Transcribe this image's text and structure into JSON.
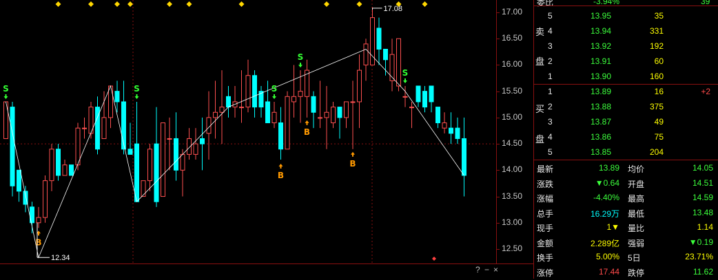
{
  "y_axis": {
    "ticks": [
      "17.00",
      "16.50",
      "16.00",
      "15.50",
      "15.00",
      "14.50",
      "14.00",
      "13.50",
      "13.00",
      "12.50"
    ]
  },
  "annotations": {
    "high": "17.08",
    "low": "12.34"
  },
  "signals": {
    "buy": "B",
    "sell": "S"
  },
  "candles": [
    [
      14.6,
      15.3,
      14.7,
      15.3
    ],
    [
      15.2,
      15.3,
      13.5,
      13.7
    ],
    [
      14.0,
      14.0,
      13.4,
      13.6
    ],
    [
      13.6,
      13.7,
      13.2,
      13.35
    ],
    [
      13.3,
      13.4,
      12.8,
      13.0
    ],
    [
      13.0,
      13.3,
      12.9,
      13.1
    ],
    [
      13.1,
      13.9,
      13.0,
      13.8
    ],
    [
      13.8,
      14.5,
      13.6,
      14.4
    ],
    [
      14.4,
      14.5,
      13.8,
      13.9
    ],
    [
      13.9,
      14.2,
      13.9,
      14.1
    ],
    [
      14.1,
      14.0,
      13.9,
      13.9
    ],
    [
      14.1,
      14.9,
      14.0,
      14.8
    ],
    [
      14.8,
      15.0,
      14.6,
      14.8
    ],
    [
      14.7,
      15.3,
      14.6,
      15.2
    ],
    [
      15.2,
      15.4,
      14.3,
      14.4
    ],
    [
      14.6,
      15.5,
      14.6,
      15.0
    ],
    [
      15.0,
      15.6,
      14.8,
      15.6
    ],
    [
      15.5,
      15.7,
      15.1,
      15.3
    ],
    [
      15.3,
      15.7,
      14.3,
      14.4
    ],
    [
      14.4,
      14.9,
      14.3,
      14.3
    ],
    [
      14.5,
      15.3,
      13.4,
      13.4
    ],
    [
      13.5,
      13.8,
      13.5,
      13.8
    ],
    [
      13.8,
      14.5,
      13.6,
      14.4
    ],
    [
      14.5,
      15.2,
      13.3,
      13.4
    ],
    [
      13.5,
      14.9,
      13.5,
      14.9
    ],
    [
      14.6,
      15.0,
      14.0,
      14.6
    ],
    [
      14.6,
      15.1,
      13.8,
      14.0
    ],
    [
      14.0,
      14.4,
      13.5,
      14.3
    ],
    [
      14.3,
      14.8,
      14.2,
      14.6
    ],
    [
      14.3,
      14.8,
      14.2,
      14.5
    ],
    [
      14.6,
      15.0,
      14.0,
      14.5
    ],
    [
      14.7,
      15.5,
      14.2,
      15.0
    ],
    [
      15.0,
      15.7,
      14.6,
      15.1
    ],
    [
      15.1,
      15.9,
      14.5,
      15.2
    ],
    [
      15.4,
      15.6,
      15.0,
      15.2
    ],
    [
      15.2,
      15.6,
      15.0,
      15.3
    ],
    [
      15.2,
      15.9,
      14.9,
      15.2
    ],
    [
      15.2,
      16.1,
      15.1,
      15.8
    ],
    [
      15.8,
      15.9,
      15.0,
      15.2
    ],
    [
      15.5,
      15.6,
      15.0,
      15.2
    ],
    [
      15.3,
      15.7,
      14.9,
      14.9
    ],
    [
      14.9,
      15.3,
      14.8,
      15.1
    ],
    [
      14.9,
      15.2,
      14.2,
      14.4
    ],
    [
      14.4,
      15.5,
      14.4,
      15.4
    ],
    [
      15.3,
      16.0,
      15.0,
      15.4
    ],
    [
      15.4,
      15.9,
      14.9,
      15.5
    ],
    [
      15.4,
      16.1,
      15.0,
      15.9
    ],
    [
      15.4,
      15.5,
      14.8,
      15.1
    ],
    [
      15.0,
      15.7,
      14.8,
      15.0
    ],
    [
      15.0,
      15.6,
      14.4,
      15.1
    ],
    [
      14.9,
      15.3,
      14.8,
      15.2
    ],
    [
      15.2,
      15.2,
      14.6,
      15.0
    ],
    [
      15.0,
      15.3,
      14.8,
      15.3
    ],
    [
      15.3,
      15.7,
      14.4,
      15.3
    ],
    [
      15.3,
      16.2,
      14.8,
      15.9
    ],
    [
      16.0,
      16.5,
      15.7,
      16.4
    ],
    [
      16.0,
      17.1,
      16.3,
      16.9
    ],
    [
      16.7,
      16.9,
      16.0,
      16.3
    ],
    [
      16.3,
      16.3,
      15.8,
      16.1
    ],
    [
      15.7,
      16.5,
      15.5,
      16.2
    ],
    [
      15.6,
      16.5,
      15.5,
      16.5
    ],
    [
      15.4,
      15.6,
      15.2,
      15.4
    ],
    [
      15.2,
      15.3,
      14.8,
      15.2
    ],
    [
      15.6,
      15.6,
      15.2,
      15.3
    ],
    [
      15.5,
      15.6,
      15.1,
      15.2
    ],
    [
      15.6,
      15.6,
      15.1,
      15.3
    ],
    [
      15.2,
      15.2,
      14.8,
      14.9
    ],
    [
      14.8,
      15.1,
      14.7,
      14.9
    ],
    [
      14.8,
      15.1,
      14.5,
      14.7
    ],
    [
      14.8,
      15.0,
      14.5,
      14.6
    ],
    [
      14.6,
      15.0,
      13.5,
      13.9
    ]
  ],
  "buy_signals": [
    5,
    42,
    46,
    53
  ],
  "sell_signals": [
    0,
    20,
    41,
    45,
    61
  ],
  "buy_marker_low_offset": [
    4,
    6,
    4,
    4
  ],
  "zigzag": [
    [
      15.3,
      0
    ],
    [
      12.34,
      5
    ],
    [
      15.6,
      16
    ],
    [
      13.4,
      20
    ],
    [
      15.2,
      34
    ],
    [
      16.3,
      55
    ],
    [
      15.5,
      61
    ],
    [
      13.9,
      70
    ]
  ],
  "top_markers": [
    8,
    13,
    17,
    19,
    25,
    28,
    36,
    49,
    54,
    60,
    64
  ],
  "extra_markers": [
    {
      "price": 12.5,
      "idx": 65
    }
  ],
  "bottom_controls": [
    "?",
    "−",
    "×"
  ],
  "order_book": {
    "header": {
      "label": "委比",
      "value": "-3.94%",
      "diff": "39"
    },
    "ask_side": "卖盘",
    "bid_side": "买盘",
    "asks": [
      {
        "level": "5",
        "price": "13.95",
        "volume": "35",
        "change": ""
      },
      {
        "level": "4",
        "price": "13.94",
        "volume": "331",
        "change": ""
      },
      {
        "level": "3",
        "price": "13.92",
        "volume": "192",
        "change": ""
      },
      {
        "level": "2",
        "price": "13.91",
        "volume": "60",
        "change": ""
      },
      {
        "level": "1",
        "price": "13.90",
        "volume": "160",
        "change": ""
      }
    ],
    "bids": [
      {
        "level": "1",
        "price": "13.89",
        "volume": "16",
        "change": "+2"
      },
      {
        "level": "2",
        "price": "13.88",
        "volume": "375",
        "change": ""
      },
      {
        "level": "3",
        "price": "13.87",
        "volume": "49",
        "change": ""
      },
      {
        "level": "4",
        "price": "13.86",
        "volume": "75",
        "change": ""
      },
      {
        "level": "5",
        "price": "13.85",
        "volume": "204",
        "change": ""
      }
    ]
  },
  "stats": [
    {
      "l1": "最新",
      "v1": "13.89",
      "c1": "green",
      "l2": "均价",
      "v2": "14.05",
      "c2": "green"
    },
    {
      "l1": "涨跌",
      "v1": "▼0.64",
      "c1": "green",
      "l2": "开盘",
      "v2": "14.51",
      "c2": "green"
    },
    {
      "l1": "涨幅",
      "v1": "-4.40%",
      "c1": "green",
      "l2": "最高",
      "v2": "14.59",
      "c2": "green"
    },
    {
      "l1": "总手",
      "v1": "16.29万",
      "c1": "cyan",
      "l2": "最低",
      "v2": "13.48",
      "c2": "green"
    },
    {
      "l1": "现手",
      "v1": "1▼",
      "c1": "yellow",
      "l2": "量比",
      "v2": "1.14",
      "c2": "yellow"
    },
    {
      "l1": "金额",
      "v1": "2.289亿",
      "c1": "yellow",
      "l2": "强弱",
      "v2": "▼0.19",
      "c2": "green"
    },
    {
      "l1": "换手",
      "v1": "5.00%",
      "c1": "yellow",
      "l2": "5日",
      "v2": "23.71%",
      "c2": "yellow"
    },
    {
      "l1": "涨停",
      "v1": "17.44",
      "c1": "red",
      "l2": "跌停",
      "v2": "11.62",
      "c2": "green"
    }
  ],
  "colors": {
    "up": "#ff5050",
    "down": "#00ffff",
    "grid": "#8a1010",
    "buy": "#ff9900",
    "sell": "#33ff33",
    "marker": "#ffd700"
  }
}
